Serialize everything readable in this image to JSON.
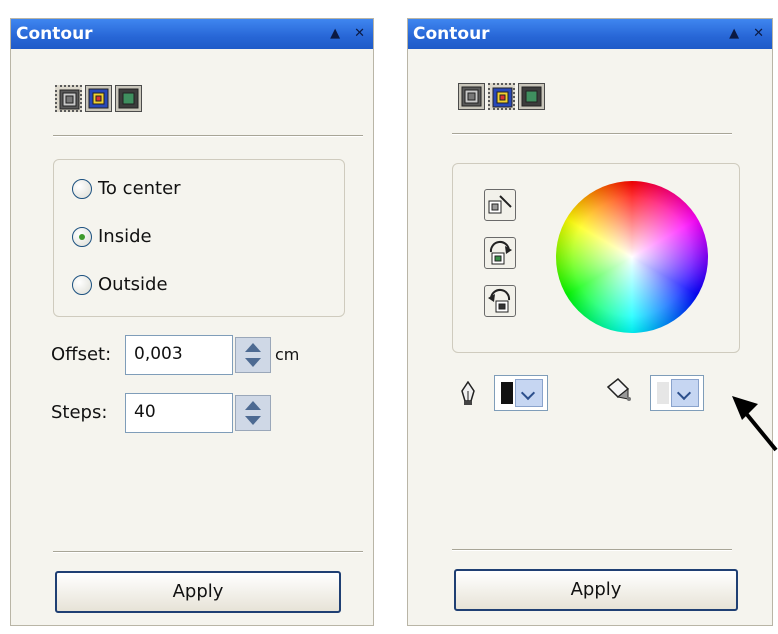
{
  "left_panel": {
    "title": "Contour",
    "title_icons": [
      "collapse-up-icon",
      "close-icon"
    ],
    "mode_buttons": [
      "to-center-icon",
      "inside-icon",
      "outside-icon"
    ],
    "radio_options": [
      {
        "label": "To center",
        "checked": false
      },
      {
        "label": "Inside",
        "checked": true
      },
      {
        "label": "Outside",
        "checked": false
      }
    ],
    "offset": {
      "label": "Offset:",
      "value": "0,003",
      "unit": "cm"
    },
    "steps": {
      "label": "Steps:",
      "value": "40"
    },
    "apply_label": "Apply"
  },
  "right_panel": {
    "title": "Contour",
    "title_icons": [
      "collapse-up-icon",
      "close-icon"
    ],
    "mode_buttons": [
      "to-center-icon",
      "inside-icon",
      "outside-icon"
    ],
    "color_tools": [
      "direct-blend-icon",
      "clockwise-blend-icon",
      "counterclockwise-blend-icon"
    ],
    "outline_color": "#111111",
    "fill_color": "#e6e6e6",
    "apply_label": "Apply"
  },
  "colors": {
    "title_bar": "#2766d6",
    "panel_bg": "#f5f4ee",
    "radio_dot": "#3d9a2b"
  }
}
